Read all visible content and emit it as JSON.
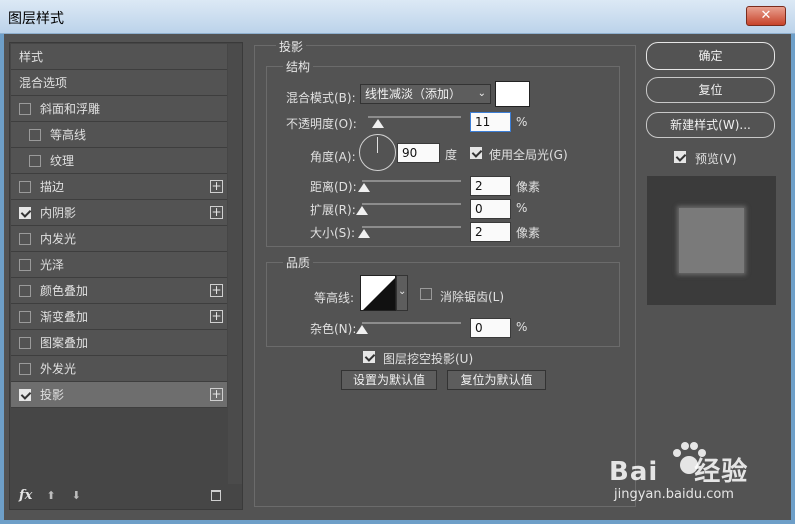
{
  "window": {
    "title": "图层样式",
    "close_glyph": "✕"
  },
  "styles_panel": {
    "items": [
      {
        "label": "样式",
        "has_checkbox": false,
        "checked": false,
        "has_plus": false,
        "selected": false,
        "indent": false
      },
      {
        "label": "混合选项",
        "has_checkbox": false,
        "checked": false,
        "has_plus": false,
        "selected": false,
        "indent": false
      },
      {
        "label": "斜面和浮雕",
        "has_checkbox": true,
        "checked": false,
        "has_plus": false,
        "selected": false,
        "indent": false
      },
      {
        "label": "等高线",
        "has_checkbox": true,
        "checked": false,
        "has_plus": false,
        "selected": false,
        "indent": true
      },
      {
        "label": "纹理",
        "has_checkbox": true,
        "checked": false,
        "has_plus": false,
        "selected": false,
        "indent": true
      },
      {
        "label": "描边",
        "has_checkbox": true,
        "checked": false,
        "has_plus": true,
        "selected": false,
        "indent": false
      },
      {
        "label": "内阴影",
        "has_checkbox": true,
        "checked": true,
        "has_plus": true,
        "selected": false,
        "indent": false
      },
      {
        "label": "内发光",
        "has_checkbox": true,
        "checked": false,
        "has_plus": false,
        "selected": false,
        "indent": false
      },
      {
        "label": "光泽",
        "has_checkbox": true,
        "checked": false,
        "has_plus": false,
        "selected": false,
        "indent": false
      },
      {
        "label": "颜色叠加",
        "has_checkbox": true,
        "checked": false,
        "has_plus": true,
        "selected": false,
        "indent": false
      },
      {
        "label": "渐变叠加",
        "has_checkbox": true,
        "checked": false,
        "has_plus": true,
        "selected": false,
        "indent": false
      },
      {
        "label": "图案叠加",
        "has_checkbox": true,
        "checked": false,
        "has_plus": false,
        "selected": false,
        "indent": false
      },
      {
        "label": "外发光",
        "has_checkbox": true,
        "checked": false,
        "has_plus": false,
        "selected": false,
        "indent": false
      },
      {
        "label": "投影",
        "has_checkbox": true,
        "checked": true,
        "has_plus": true,
        "selected": true,
        "indent": false
      }
    ],
    "footer": {
      "fx_label": "fx",
      "up_glyph": "⬆",
      "down_glyph": "⬇",
      "trash_glyph": "🗑"
    }
  },
  "drop_shadow": {
    "section_title": "投影",
    "structure": {
      "title": "结构",
      "blend_mode_label": "混合模式(B):",
      "blend_mode_value": "线性减淡（添加）",
      "opacity_label": "不透明度(O):",
      "opacity_value": "11",
      "opacity_unit": "%",
      "opacity_fraction": 0.11,
      "angle_label": "角度(A):",
      "angle_value": "90",
      "angle_unit": "度",
      "global_light_label": "使用全局光(G)",
      "global_light_checked": true,
      "distance_label": "距离(D):",
      "distance_value": "2",
      "distance_unit": "像素",
      "distance_fraction": 0.02,
      "spread_label": "扩展(R):",
      "spread_value": "0",
      "spread_unit": "%",
      "spread_fraction": 0,
      "size_label": "大小(S):",
      "size_value": "2",
      "size_unit": "像素",
      "size_fraction": 0.02
    },
    "quality": {
      "title": "品质",
      "contour_label": "等高线:",
      "anti_alias_label": "消除锯齿(L)",
      "anti_alias_checked": false,
      "noise_label": "杂色(N):",
      "noise_value": "0",
      "noise_unit": "%",
      "noise_fraction": 0
    },
    "knockout_label": "图层挖空投影(U)",
    "knockout_checked": true,
    "make_default_label": "设置为默认值",
    "reset_default_label": "复位为默认值"
  },
  "right_panel": {
    "ok_label": "确定",
    "reset_label": "复位",
    "new_style_label": "新建样式(W)...",
    "preview_label": "预览(V)",
    "preview_checked": true
  },
  "colors": {
    "dialog_bg": "#535353",
    "shadow_color": "#ffffff",
    "selected_row": "#6e6e6e"
  }
}
